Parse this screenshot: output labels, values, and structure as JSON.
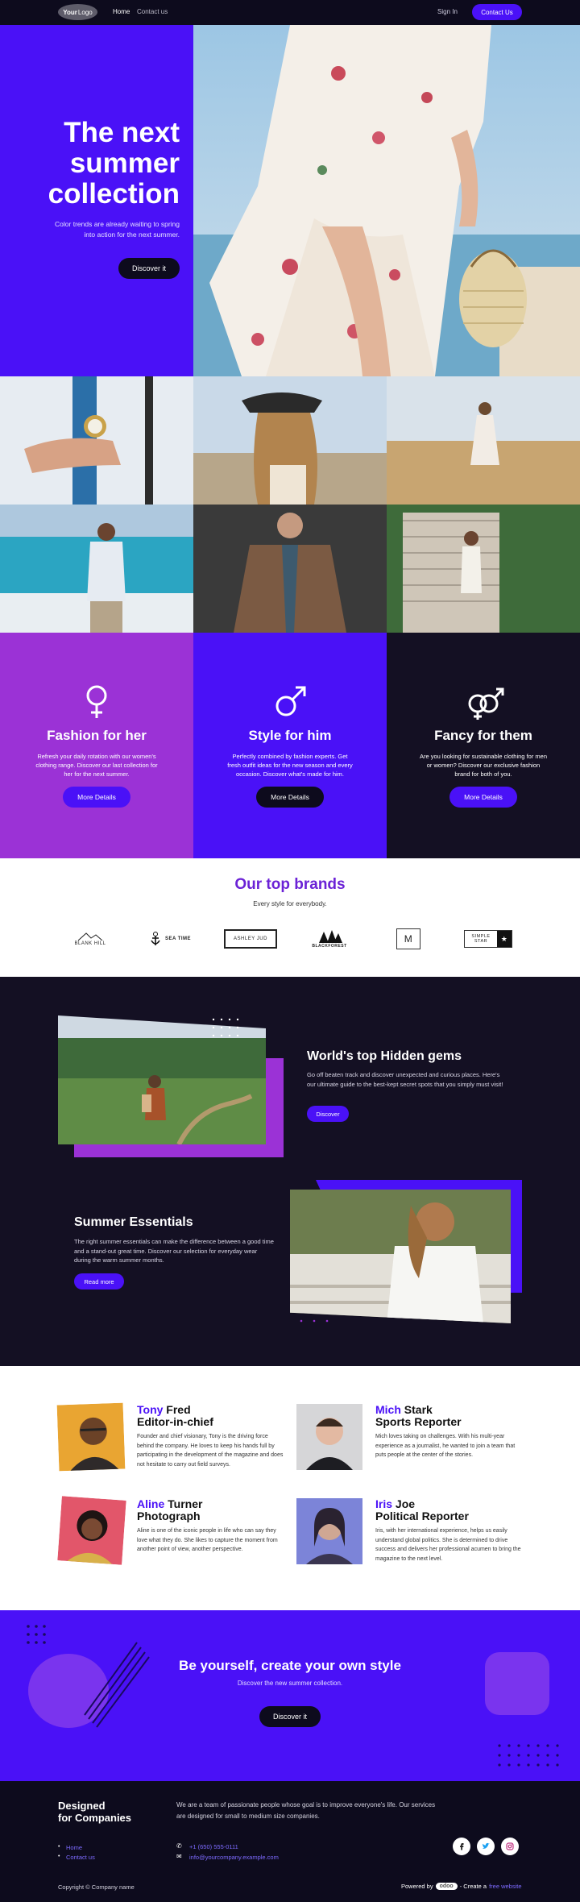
{
  "header": {
    "logo_main": "Your",
    "logo_rest": "Logo",
    "nav": [
      "Home",
      "Contact us"
    ],
    "sign_in": "Sign In",
    "contact_button": "Contact Us"
  },
  "hero": {
    "title_lines": [
      "The next",
      "summer",
      "collection"
    ],
    "subtitle": "Color trends are already waiting to spring into action for the next summer.",
    "button": "Discover it"
  },
  "categories": [
    {
      "title": "Fashion for her",
      "text": "Refresh your daily rotation with our women's clothing range. Discover our last collection for her for the next summer.",
      "button": "More Details",
      "icon": "female-symbol-icon",
      "bg": "#9b32d6",
      "btn_bg": "#4a11f7"
    },
    {
      "title": "Style for him",
      "text": "Perfectly combined by fashion experts. Get fresh outfit ideas for the new season and every occasion. Discover what's made for him.",
      "button": "More Details",
      "icon": "male-symbol-icon",
      "bg": "#4a11f7",
      "btn_bg": "#0d0b1d"
    },
    {
      "title": "Fancy for them",
      "text": "Are you looking for sustainable clothing for men or women? Discover our exclusive fashion brand for both of you.",
      "button": "More Details",
      "icon": "genders-symbol-icon",
      "bg": "#141023",
      "btn_bg": "#4a11f7"
    }
  ],
  "brands": {
    "title": "Our top brands",
    "subtitle": "Every style for everybody.",
    "logos": [
      "BLANK HILL",
      "SEA TIME",
      "ASHLEY JUD",
      "BLACKFOREST",
      "M",
      "SIMPLE STAR"
    ]
  },
  "features": [
    {
      "title": "World's top Hidden gems",
      "text": "Go off beaten track and discover unexpected and curious places. Here's our ultimate guide to the best-kept secret spots that you simply must visit!",
      "button": "Discover"
    },
    {
      "title": "Summer Essentials",
      "text": "The right summer essentials can make the difference between a good time and a stand-out great time. Discover our selection for everyday wear during the warm summer months.",
      "button": "Read more"
    }
  ],
  "team": [
    {
      "first": "Tony",
      "last": "Fred",
      "role": "Editor-in-chief",
      "bio": "Founder and chief visionary, Tony is the driving force behind the company. He loves to keep his hands full by participating in the development of the magazine and does not hesitate to carry out field surveys."
    },
    {
      "first": "Mich",
      "last": "Stark",
      "role": "Sports Reporter",
      "bio": "Mich loves taking on challenges. With his multi-year experience as a journalist, he wanted to join a team that puts people at the center of the stories."
    },
    {
      "first": "Aline",
      "last": "Turner",
      "role": "Photograph",
      "bio": "Aline is one of the iconic people in life who can say they love what they do. She likes to capture the moment from another point of view, another perspective."
    },
    {
      "first": "Iris",
      "last": "Joe",
      "role": "Political Reporter",
      "bio": "Iris, with her international experience, helps us easily understand global politics. She is determined to drive success and delivers her professional acumen to bring the magazine to the next level."
    }
  ],
  "cta": {
    "title": "Be yourself, create your own style",
    "subtitle": "Discover the new summer collection.",
    "button": "Discover it"
  },
  "footer": {
    "title_lines": [
      "Designed",
      "for Companies"
    ],
    "description": "We are a team of passionate people whose goal is to improve everyone's life. Our services are designed for small to medium size companies.",
    "links": [
      "Home",
      "Contact us"
    ],
    "phone": "+1 (650) 555-0111",
    "email": "info@yourcompany.example.com",
    "copyright": "Copyright © Company name",
    "powered_by": "Powered by",
    "odoo": "odoo",
    "create_text": "- Create a",
    "free_website": "free website"
  },
  "colors": {
    "accent": "#4a11f7",
    "dark": "#0d0b1d",
    "purple": "#9b32d6"
  }
}
